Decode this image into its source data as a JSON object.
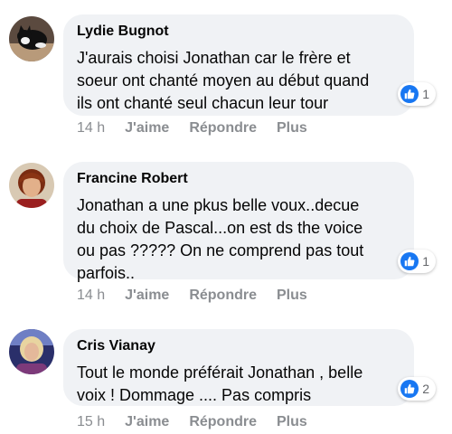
{
  "comments": [
    {
      "author": "Lydie Bugnot",
      "text_lines": [
        "J'aurais choisi Jonathan car le frère et",
        "soeur ont chanté moyen au début quand",
        "ils ont chanté seul chacun leur tour"
      ],
      "reaction_count": "1",
      "time": "14 h"
    },
    {
      "author": "Francine Robert",
      "text_lines": [
        "Jonathan a une pkus belle voux..decue",
        "du choix de Pascal...on est ds the voice",
        "ou pas ????? On ne comprend pas tout",
        "parfois.."
      ],
      "reaction_count": "1",
      "time": "14 h"
    },
    {
      "author": "Cris Vianay",
      "text_lines": [
        "Tout le monde préférait Jonathan , belle",
        "voix ! Dommage .... Pas compris"
      ],
      "reaction_count": "2",
      "time": "15 h"
    }
  ],
  "actions": {
    "like_label": "J'aime",
    "reply_label": "Répondre",
    "more_label": "Plus"
  },
  "icons": {
    "reaction": "like-thumb-icon"
  },
  "colors": {
    "bubble": "#f0f2f5",
    "like_blue": "#1877f2",
    "meta_gray": "#8a8d91"
  }
}
